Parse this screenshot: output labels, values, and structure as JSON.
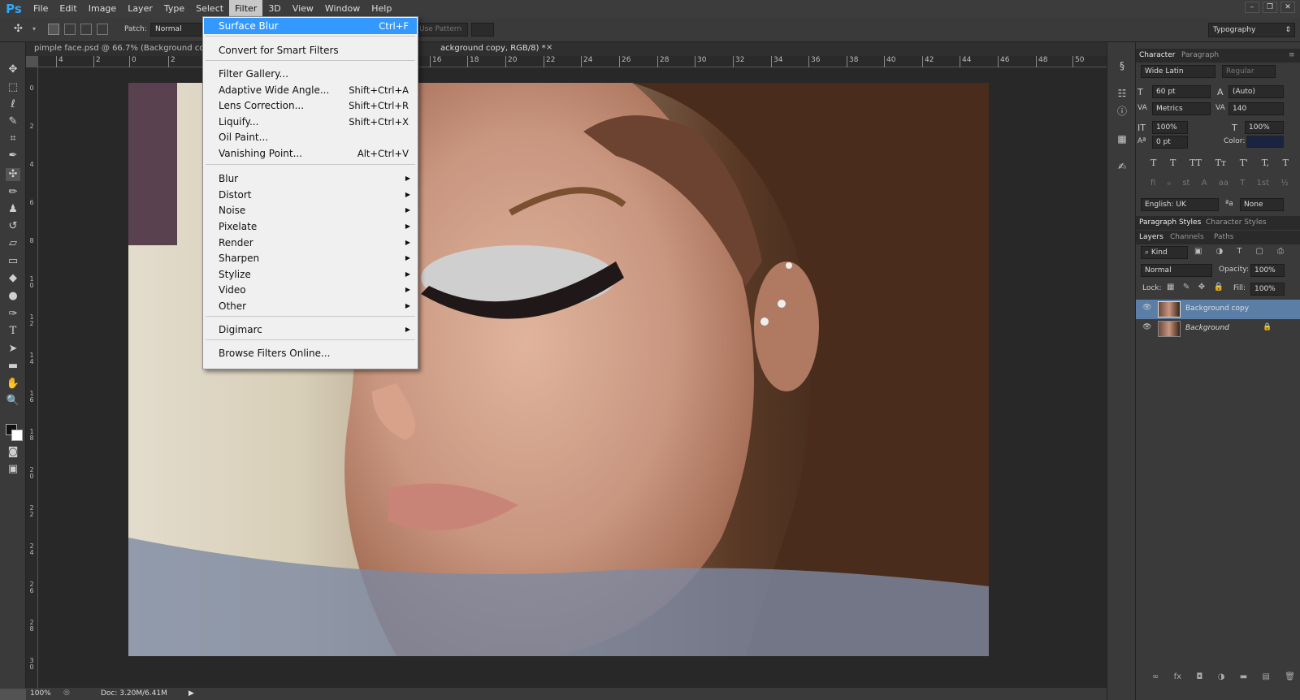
{
  "app": {
    "logo": "Ps"
  },
  "menubar": {
    "items": [
      "File",
      "Edit",
      "Image",
      "Layer",
      "Type",
      "Select",
      "Filter",
      "3D",
      "View",
      "Window",
      "Help"
    ],
    "active_index": 6
  },
  "options_bar": {
    "patch_label": "Patch:",
    "patch_mode": "Normal",
    "use_pattern": "Use Pattern",
    "workspace": "Typography"
  },
  "document": {
    "tab_title_left": "pimple face.psd @ 66.7% (Background copy,",
    "tab_title_right": "ackground copy, RGB/8) *",
    "close_glyph": "×"
  },
  "ruler": {
    "h_labels": [
      "4",
      "2",
      "0",
      "2",
      "2",
      "16",
      "18",
      "20",
      "22",
      "24",
      "26",
      "28",
      "30",
      "32",
      "34",
      "36",
      "38",
      "40",
      "42",
      "44",
      "46",
      "48",
      "50"
    ],
    "v_labels": [
      "0",
      "2",
      "4",
      "6",
      "8",
      "1 0",
      "1 2",
      "1 4",
      "1 6",
      "1 8",
      "2 0",
      "2 2",
      "2 4",
      "2 6",
      "2 8",
      "3 0"
    ]
  },
  "status": {
    "zoom": "100%",
    "doc_info": "Doc: 3.20M/6.41M"
  },
  "filter_menu": {
    "items": [
      {
        "label": "Surface Blur",
        "shortcut": "Ctrl+F",
        "highlighted": true
      },
      {
        "label": "Convert for Smart Filters",
        "shortcut": ""
      },
      {
        "label": "Filter Gallery...",
        "shortcut": ""
      },
      {
        "label": "Adaptive Wide Angle...",
        "shortcut": "Shift+Ctrl+A"
      },
      {
        "label": "Lens Correction...",
        "shortcut": "Shift+Ctrl+R"
      },
      {
        "label": "Liquify...",
        "shortcut": "Shift+Ctrl+X"
      },
      {
        "label": "Oil Paint...",
        "shortcut": ""
      },
      {
        "label": "Vanishing Point...",
        "shortcut": "Alt+Ctrl+V"
      },
      {
        "label": "Blur",
        "submenu": true
      },
      {
        "label": "Distort",
        "submenu": true
      },
      {
        "label": "Noise",
        "submenu": true
      },
      {
        "label": "Pixelate",
        "submenu": true
      },
      {
        "label": "Render",
        "submenu": true
      },
      {
        "label": "Sharpen",
        "submenu": true
      },
      {
        "label": "Stylize",
        "submenu": true
      },
      {
        "label": "Video",
        "submenu": true
      },
      {
        "label": "Other",
        "submenu": true
      },
      {
        "label": "Digimarc",
        "submenu": true
      },
      {
        "label": "Browse Filters Online...",
        "shortcut": ""
      }
    ]
  },
  "character_panel": {
    "tabs": [
      "Character",
      "Paragraph"
    ],
    "font_family": "Wide Latin",
    "font_style": "Regular",
    "font_size": "60 pt",
    "leading": "(Auto)",
    "kerning": "Metrics",
    "tracking": "140",
    "vertical_scale": "100%",
    "horizontal_scale": "100%",
    "baseline_shift": "0 pt",
    "color_label": "Color:",
    "color": "#1a2440",
    "style_buttons": [
      "T",
      "T",
      "TT",
      "Tт",
      "T'",
      "T,",
      "T"
    ],
    "opentype_buttons": [
      "fi",
      "ℴ",
      "st",
      "A",
      "aa",
      "T",
      "1st",
      "½"
    ],
    "language": "English: UK",
    "aa_icon": "ªa",
    "antialias": "None"
  },
  "styles_tabs": [
    "Paragraph Styles",
    "Character Styles"
  ],
  "layers_panel": {
    "tabs": [
      "Layers",
      "Channels",
      "Paths"
    ],
    "kind": "Kind",
    "blend_mode": "Normal",
    "opacity_label": "Opacity:",
    "opacity": "100%",
    "lock_label": "Lock:",
    "fill_label": "Fill:",
    "fill": "100%",
    "layers": [
      {
        "name": "Background copy",
        "selected": true
      },
      {
        "name": "Background",
        "selected": false,
        "locked": true
      }
    ],
    "bottom_icons": [
      "∞",
      "fx",
      "◘",
      "◑",
      "▬",
      "▤",
      "🗑"
    ]
  },
  "colors": {
    "accent": "#3399ff",
    "selected_layer": "#5b7ea6",
    "panel": "#3a3a3a",
    "pasteboard": "#282828"
  }
}
